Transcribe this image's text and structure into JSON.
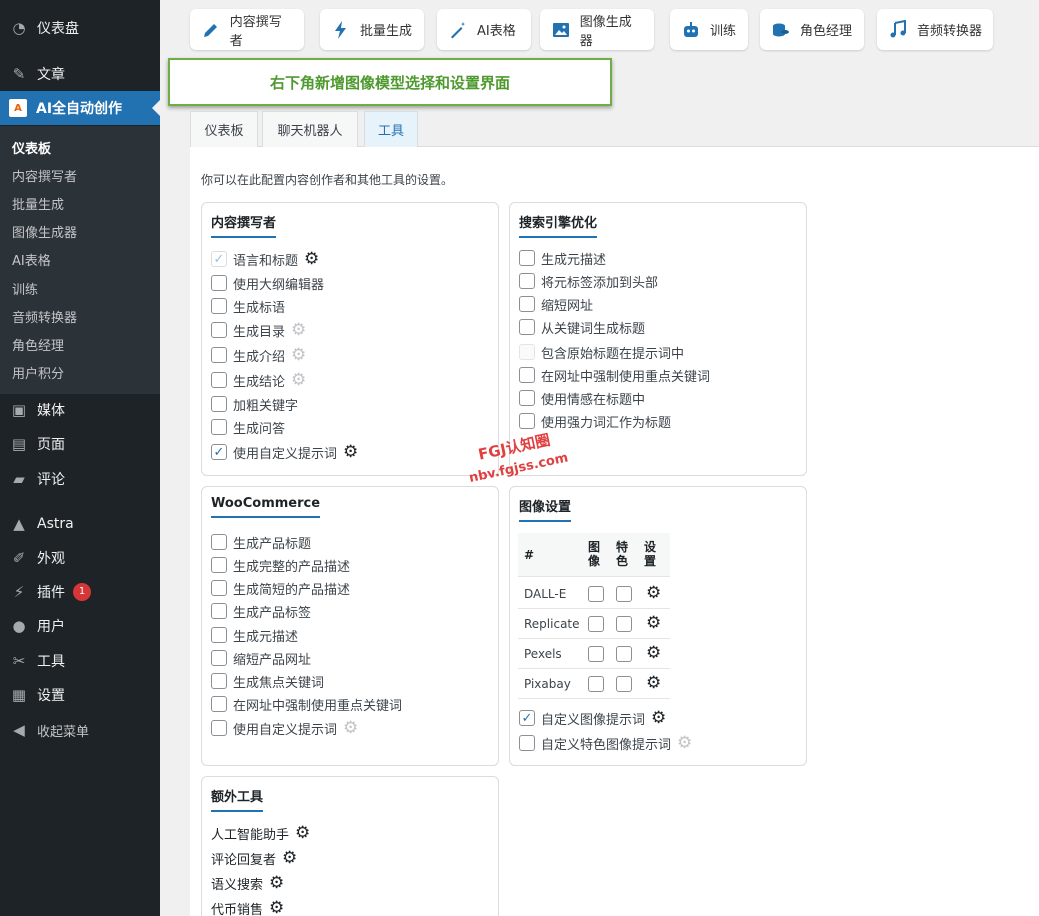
{
  "sidebar": {
    "items": [
      {
        "label": "仪表盘",
        "icon": "dashboard-icon",
        "glyph": "◔",
        "name": "sidebar-item-dashboard"
      },
      {
        "label": "文章",
        "icon": "pin-icon",
        "glyph": "✎",
        "name": "sidebar-item-posts"
      },
      {
        "label": "AI全自动创作",
        "icon": "ai-logo-icon",
        "glyph": "A",
        "name": "sidebar-item-ai"
      },
      {
        "label": "媒体",
        "icon": "media-icon",
        "glyph": "▣",
        "name": "sidebar-item-media"
      },
      {
        "label": "页面",
        "icon": "page-icon",
        "glyph": "▤",
        "name": "sidebar-item-pages"
      },
      {
        "label": "评论",
        "icon": "comment-icon",
        "glyph": "▰",
        "name": "sidebar-item-comments"
      },
      {
        "label": "Astra",
        "icon": "astra-icon",
        "glyph": "▲",
        "name": "sidebar-item-astra"
      },
      {
        "label": "外观",
        "icon": "brush-icon",
        "glyph": "✐",
        "name": "sidebar-item-appearance"
      },
      {
        "label": "插件",
        "icon": "plug-icon",
        "glyph": "⚡",
        "name": "sidebar-item-plugins",
        "badge": "1"
      },
      {
        "label": "用户",
        "icon": "user-icon",
        "glyph": "●",
        "name": "sidebar-item-users"
      },
      {
        "label": "工具",
        "icon": "wrench-icon",
        "glyph": "✂",
        "name": "sidebar-item-tools"
      },
      {
        "label": "设置",
        "icon": "settings-icon",
        "glyph": "▦",
        "name": "sidebar-item-settings"
      },
      {
        "label": "收起菜单",
        "icon": "collapse-icon",
        "glyph": "◀",
        "name": "sidebar-item-collapse"
      }
    ],
    "submenu": [
      "仪表板",
      "内容撰写者",
      "批量生成",
      "图像生成器",
      "AI表格",
      "训练",
      "音频转换器",
      "角色经理",
      "用户积分"
    ]
  },
  "toolbar": {
    "buttons": [
      {
        "label": "内容撰写者",
        "icon": "pencil-icon"
      },
      {
        "label": "批量生成",
        "icon": "bolt-icon"
      },
      {
        "label": "AI表格",
        "icon": "magic-wand-icon"
      },
      {
        "label": "图像生成器",
        "icon": "image-icon"
      },
      {
        "label": "训练",
        "icon": "robot-icon"
      },
      {
        "label": "角色经理",
        "icon": "coins-icon"
      },
      {
        "label": "音频转换器",
        "icon": "music-icon"
      }
    ]
  },
  "callout": "右下角新增图像模型选择和设置界面",
  "tabs": [
    "仪表板",
    "聊天机器人",
    "工具"
  ],
  "active_tab": "工具",
  "intro": "你可以在此配置内容创作者和其他工具的设置。",
  "content_writer": {
    "title": "内容撰写者",
    "options": [
      {
        "label": "语言和标题",
        "checked": true,
        "disabled": true,
        "gear": "dark"
      },
      {
        "label": "使用大纲编辑器",
        "checked": false,
        "gear": "none"
      },
      {
        "label": "生成标语",
        "checked": false,
        "gear": "none"
      },
      {
        "label": "生成目录",
        "checked": false,
        "gear": "dim"
      },
      {
        "label": "生成介绍",
        "checked": false,
        "gear": "dim"
      },
      {
        "label": "生成结论",
        "checked": false,
        "gear": "dim"
      },
      {
        "label": "加粗关键字",
        "checked": false,
        "gear": "none"
      },
      {
        "label": "生成问答",
        "checked": false,
        "gear": "none"
      },
      {
        "label": "使用自定义提示词",
        "checked": true,
        "gear": "dark"
      }
    ]
  },
  "seo": {
    "title": "搜索引擎优化",
    "options": [
      {
        "label": "生成元描述",
        "checked": false
      },
      {
        "label": "将元标签添加到头部",
        "checked": false
      },
      {
        "label": "缩短网址",
        "checked": false
      },
      {
        "label": "从关键词生成标题",
        "checked": false
      },
      {
        "label": "包含原始标题在提示词中",
        "checked": false,
        "faded": true
      },
      {
        "label": "在网址中强制使用重点关键词",
        "checked": false
      },
      {
        "label": "使用情感在标题中",
        "checked": false
      },
      {
        "label": "使用强力词汇作为标题",
        "checked": false
      }
    ]
  },
  "woocommerce": {
    "title": "WooCommerce",
    "options": [
      {
        "label": "生成产品标题",
        "checked": false,
        "gear": "none"
      },
      {
        "label": "生成完整的产品描述",
        "checked": false,
        "gear": "none"
      },
      {
        "label": "生成简短的产品描述",
        "checked": false,
        "gear": "none"
      },
      {
        "label": "生成产品标签",
        "checked": false,
        "gear": "none"
      },
      {
        "label": "生成元描述",
        "checked": false,
        "gear": "none"
      },
      {
        "label": "缩短产品网址",
        "checked": false,
        "gear": "none"
      },
      {
        "label": "生成焦点关键词",
        "checked": false,
        "gear": "none"
      },
      {
        "label": "在网址中强制使用重点关键词",
        "checked": false,
        "gear": "none"
      },
      {
        "label": "使用自定义提示词",
        "checked": false,
        "gear": "dim"
      }
    ]
  },
  "image_settings": {
    "title": "图像设置",
    "columns": {
      "hash": "#",
      "image": "图\n像",
      "featured": "特\n色",
      "settings": "设\n置"
    },
    "column_parts": {
      "image": [
        "图",
        "像"
      ],
      "featured": [
        "特",
        "色"
      ],
      "settings": [
        "设",
        "置"
      ]
    },
    "rows": [
      "DALL-E",
      "Replicate",
      "Pexels",
      "Pixabay"
    ],
    "custom_prompt": {
      "label": "自定义图像提示词",
      "checked": true
    },
    "custom_featured_prompt": {
      "label": "自定义特色图像提示词",
      "checked": false
    }
  },
  "extra_tools": {
    "title": "额外工具",
    "items": [
      "人工智能助手",
      "评论回复者",
      "语义搜索",
      "代币销售"
    ]
  },
  "watermark": {
    "line1": "FGJ认知圈",
    "line2": "nbv.fgjss.com"
  },
  "colors": {
    "accent": "#2271b1",
    "sidebar_bg": "#1d2327",
    "callout_border": "#70ad47",
    "watermark": "#e04040"
  }
}
